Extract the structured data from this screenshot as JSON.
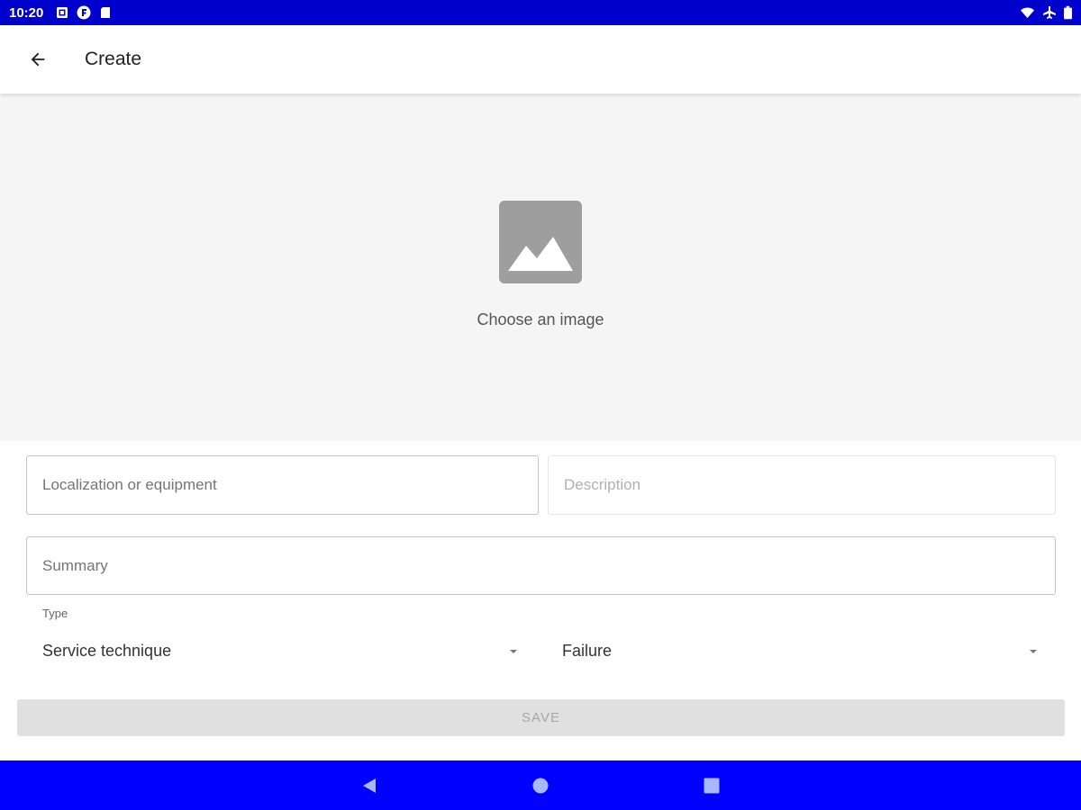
{
  "status_bar": {
    "time": "10:20",
    "left_icons": [
      "image-notification-icon",
      "f-badge-icon",
      "sd-card-icon"
    ],
    "right_icons": [
      "wifi-icon",
      "airplane-icon",
      "battery-icon"
    ]
  },
  "app_bar": {
    "title": "Create",
    "back_icon": "arrow-left-icon"
  },
  "image_chooser": {
    "icon": "image-icon",
    "label": "Choose an image"
  },
  "form": {
    "localization_placeholder": "Localization or equipment",
    "description_placeholder": "Description",
    "summary_placeholder": "Summary",
    "type_label": "Type",
    "type_value": "Service technique",
    "category_value": "Failure",
    "save_label": "SAVE"
  },
  "nav_bar": {
    "icons": [
      "nav-back-icon",
      "nav-home-icon",
      "nav-recents-icon"
    ]
  },
  "colors": {
    "status_bar": "#0000cc",
    "nav_bar": "#0000ff",
    "image_area": "#f5f5f5",
    "save_button": "#e0e0e0"
  }
}
